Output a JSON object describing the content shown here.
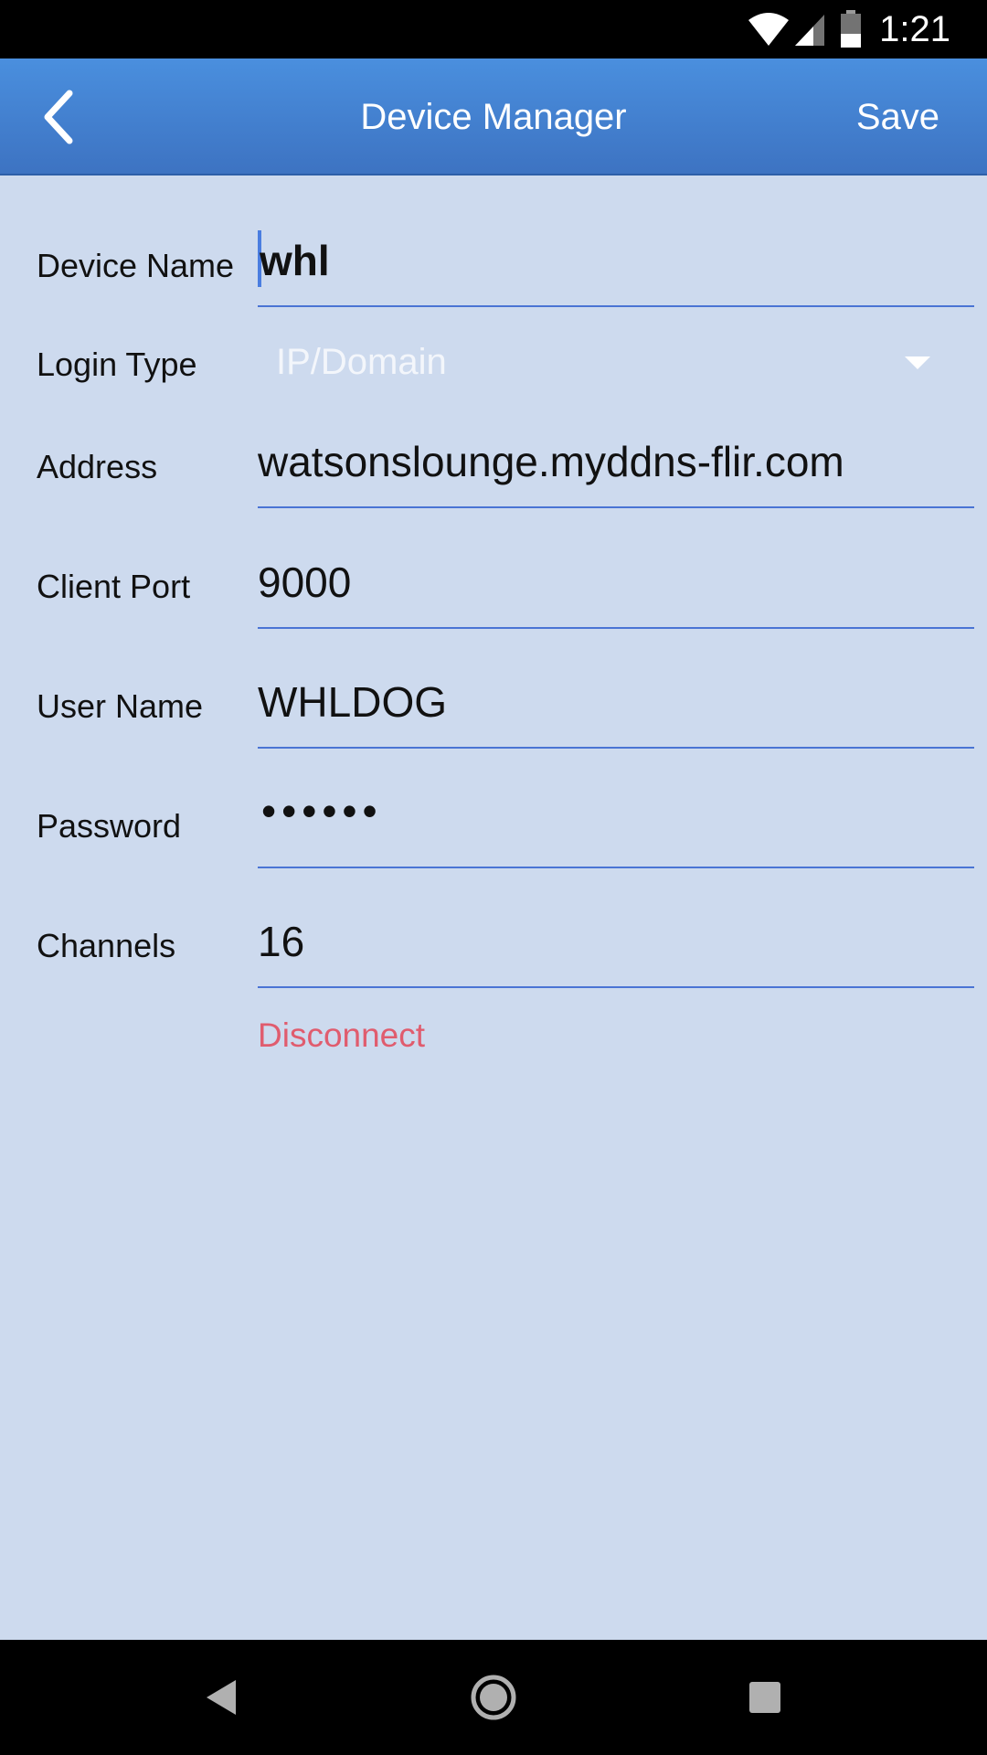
{
  "status_bar": {
    "time": "1:21",
    "icons": [
      "wifi-icon",
      "signal-icon",
      "battery-icon"
    ]
  },
  "app_bar": {
    "title": "Device Manager",
    "save_label": "Save",
    "back_icon": "chevron-left-icon"
  },
  "form": {
    "device_name": {
      "label": "Device Name",
      "value": "whl"
    },
    "login_type": {
      "label": "Login Type",
      "value": "IP/Domain"
    },
    "address": {
      "label": "Address",
      "value": "watsonslounge.myddns-flir.com"
    },
    "client_port": {
      "label": "Client Port",
      "value": "9000"
    },
    "user_name": {
      "label": "User Name",
      "value": "WHLDOG"
    },
    "password": {
      "label": "Password",
      "value": "••••••"
    },
    "channels": {
      "label": "Channels",
      "value": "16"
    }
  },
  "disconnect_label": "Disconnect",
  "nav_bar": {
    "icons": [
      "back-triangle-icon",
      "home-circle-icon",
      "recents-square-icon"
    ]
  },
  "colors": {
    "app_bar": "#4a8fde",
    "background": "#cddaee",
    "underline": "#4a74d4",
    "disconnect": "#e05c6e"
  }
}
